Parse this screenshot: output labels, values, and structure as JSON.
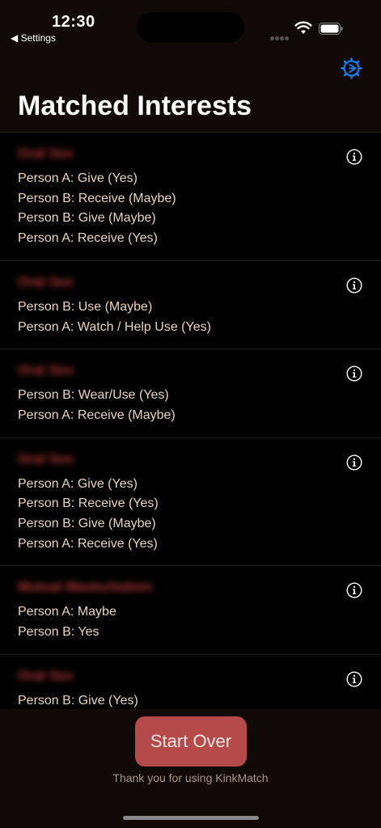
{
  "status_bar": {
    "time": "12:30",
    "back_label": "◀ Settings"
  },
  "header": {
    "title": "Matched Interests",
    "settings_icon": "gear-play-icon",
    "accent": "#0a84ff"
  },
  "items": [
    {
      "title": "Oral Sex",
      "lines": [
        "Person A: Give (Yes)",
        "Person B: Receive (Maybe)",
        "Person B: Give (Maybe)",
        "Person A: Receive (Yes)"
      ]
    },
    {
      "title": "Oral Sex",
      "lines": [
        "Person B: Use (Maybe)",
        "Person A: Watch / Help Use (Yes)"
      ]
    },
    {
      "title": "Oral Sex",
      "lines": [
        "Person B: Wear/Use (Yes)",
        "Person A: Receive (Maybe)"
      ]
    },
    {
      "title": "Oral Sex",
      "lines": [
        "Person A: Give (Yes)",
        "Person B: Receive (Yes)",
        "Person B: Give (Maybe)",
        "Person A: Receive (Yes)"
      ]
    },
    {
      "title": "Mutual Masturbation",
      "lines": [
        "Person A: Maybe",
        "Person B: Yes"
      ]
    },
    {
      "title": "Oral Sex",
      "lines": [
        "Person B: Give (Yes)"
      ]
    }
  ],
  "footer": {
    "start_over_label": "Start Over",
    "thanks_text": "Thank you for using KinkMatch",
    "button_color": "#b44a4a"
  }
}
